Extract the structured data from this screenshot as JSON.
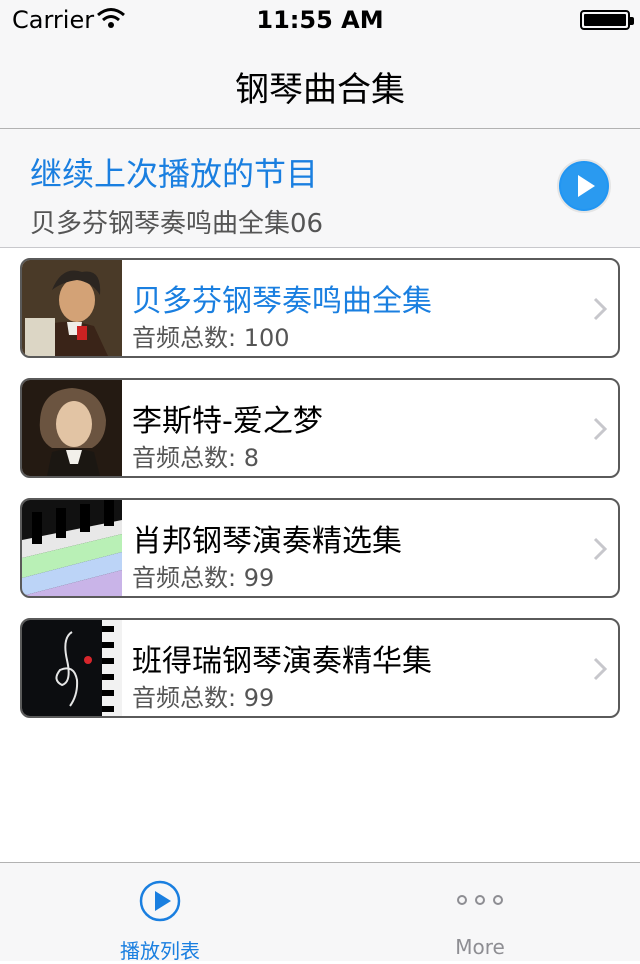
{
  "status_bar": {
    "carrier": "Carrier",
    "time": "11:55 AM"
  },
  "nav": {
    "title": "钢琴曲合集"
  },
  "resume": {
    "title": "继续上次播放的节目",
    "subtitle": "贝多芬钢琴奏鸣曲全集06"
  },
  "playlists": [
    {
      "title": "贝多芬钢琴奏鸣曲全集",
      "count": "音频总数: 100",
      "active": true
    },
    {
      "title": "李斯特-爱之梦",
      "count": "音频总数: 8",
      "active": false
    },
    {
      "title": "肖邦钢琴演奏精选集",
      "count": "音频总数: 99",
      "active": false
    },
    {
      "title": "班得瑞钢琴演奏精华集",
      "count": "音频总数: 99",
      "active": false
    }
  ],
  "tabbar": {
    "tabs": [
      {
        "label": "播放列表",
        "icon": "play-circle-icon",
        "selected": true
      },
      {
        "label": "More",
        "icon": "more-dots-icon",
        "selected": false
      }
    ]
  },
  "colors": {
    "accent": "#1a7fe0",
    "card_border": "#5a5a5a"
  }
}
